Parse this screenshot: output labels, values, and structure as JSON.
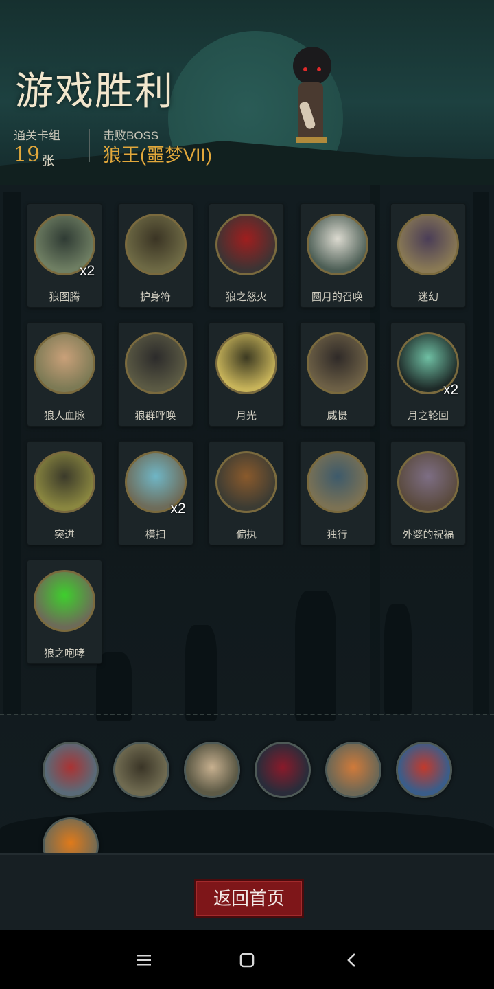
{
  "header": {
    "title": "游戏胜利",
    "cards_label": "通关卡组",
    "cards_count": "19",
    "cards_unit": "张",
    "boss_label": "击败BOSS",
    "boss_name": "狼王(噩梦VII)"
  },
  "cards": [
    {
      "label": "狼图腾",
      "multiplier": "x2",
      "icon": "wolf-totem-icon"
    },
    {
      "label": "护身符",
      "multiplier": "",
      "icon": "amulet-icon"
    },
    {
      "label": "狼之怒火",
      "multiplier": "",
      "icon": "wolf-rage-icon"
    },
    {
      "label": "圆月的召唤",
      "multiplier": "",
      "icon": "full-moon-call-icon"
    },
    {
      "label": "迷幻",
      "multiplier": "",
      "icon": "illusion-icon"
    },
    {
      "label": "狼人血脉",
      "multiplier": "",
      "icon": "werewolf-blood-icon"
    },
    {
      "label": "狼群呼唤",
      "multiplier": "",
      "icon": "pack-howl-icon"
    },
    {
      "label": "月光",
      "multiplier": "",
      "icon": "moonlight-icon"
    },
    {
      "label": "威慑",
      "multiplier": "",
      "icon": "intimidate-icon"
    },
    {
      "label": "月之轮回",
      "multiplier": "x2",
      "icon": "moon-cycle-icon"
    },
    {
      "label": "突进",
      "multiplier": "",
      "icon": "dash-icon"
    },
    {
      "label": "横扫",
      "multiplier": "x2",
      "icon": "sweep-icon"
    },
    {
      "label": "偏执",
      "multiplier": "",
      "icon": "paranoia-icon"
    },
    {
      "label": "独行",
      "multiplier": "",
      "icon": "lone-walk-icon"
    },
    {
      "label": "外婆的祝福",
      "multiplier": "",
      "icon": "grandma-blessing-icon"
    },
    {
      "label": "狼之咆哮",
      "multiplier": "",
      "icon": "wolf-roar-icon"
    }
  ],
  "relics": [
    {
      "icon": "werewolf-relic-icon"
    },
    {
      "icon": "statue-relic-icon"
    },
    {
      "icon": "hooded-elder-relic-icon"
    },
    {
      "icon": "red-book-relic-icon"
    },
    {
      "icon": "pirate-relic-icon"
    },
    {
      "icon": "red-cape-relic-icon"
    },
    {
      "icon": "flame-relic-icon"
    }
  ],
  "footer": {
    "return_label": "返回首页"
  },
  "colors": {
    "accent_gold": "#e2a83b",
    "button_red": "#7e1619",
    "card_bg": "#1c2528"
  }
}
